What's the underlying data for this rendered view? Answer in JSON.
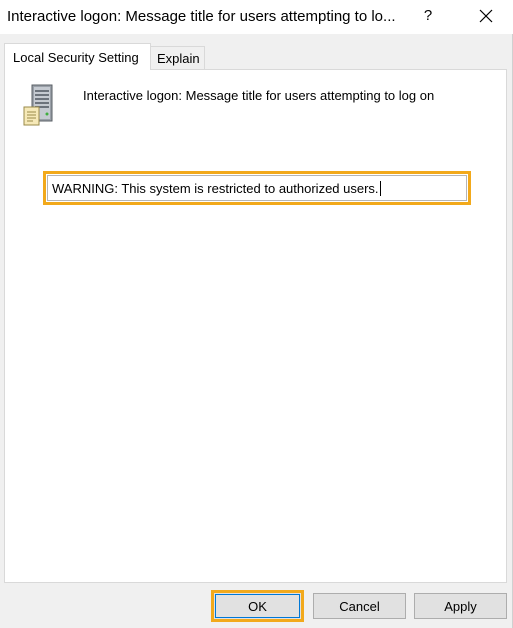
{
  "window": {
    "title": "Interactive logon: Message title for users attempting to lo...",
    "help_label": "?"
  },
  "tabs": [
    {
      "label": "Local Security Setting",
      "active": true
    },
    {
      "label": "Explain",
      "active": false
    }
  ],
  "policy": {
    "icon": "server-policy-icon",
    "name": "Interactive logon: Message title for users attempting to log on"
  },
  "message_title": {
    "value": "WARNING: This system is restricted to authorized users."
  },
  "buttons": {
    "ok": "OK",
    "cancel": "Cancel",
    "apply": "Apply"
  },
  "colors": {
    "highlight": "#f2a91b",
    "focus": "#0078d7"
  }
}
